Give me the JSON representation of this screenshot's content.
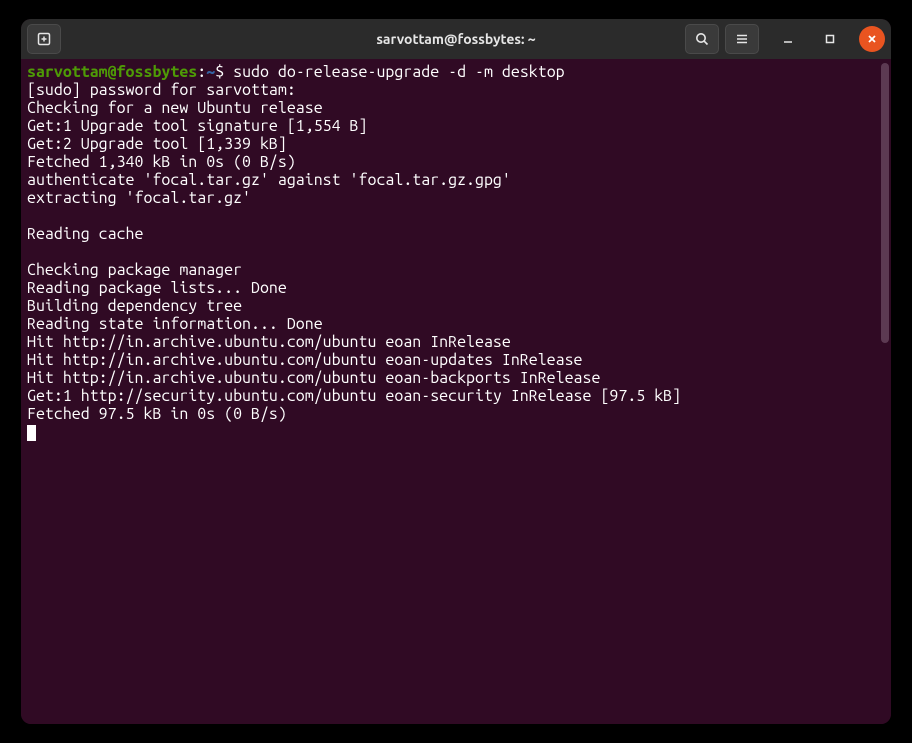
{
  "window": {
    "title": "sarvottam@fossbytes: ~"
  },
  "prompt": {
    "user_host": "sarvottam@fossbytes",
    "colon": ":",
    "path": "~",
    "dollar": "$ ",
    "command": "sudo do-release-upgrade -d -m desktop"
  },
  "output": [
    "[sudo] password for sarvottam: ",
    "Checking for a new Ubuntu release",
    "Get:1 Upgrade tool signature [1,554 B]",
    "Get:2 Upgrade tool [1,339 kB]",
    "Fetched 1,340 kB in 0s (0 B/s)",
    "authenticate 'focal.tar.gz' against 'focal.tar.gz.gpg'",
    "extracting 'focal.tar.gz'",
    "",
    "Reading cache",
    "",
    "Checking package manager",
    "Reading package lists... Done",
    "Building dependency tree",
    "Reading state information... Done",
    "Hit http://in.archive.ubuntu.com/ubuntu eoan InRelease",
    "Hit http://in.archive.ubuntu.com/ubuntu eoan-updates InRelease",
    "Hit http://in.archive.ubuntu.com/ubuntu eoan-backports InRelease",
    "Get:1 http://security.ubuntu.com/ubuntu eoan-security InRelease [97.5 kB]",
    "Fetched 97.5 kB in 0s (0 B/s)"
  ]
}
